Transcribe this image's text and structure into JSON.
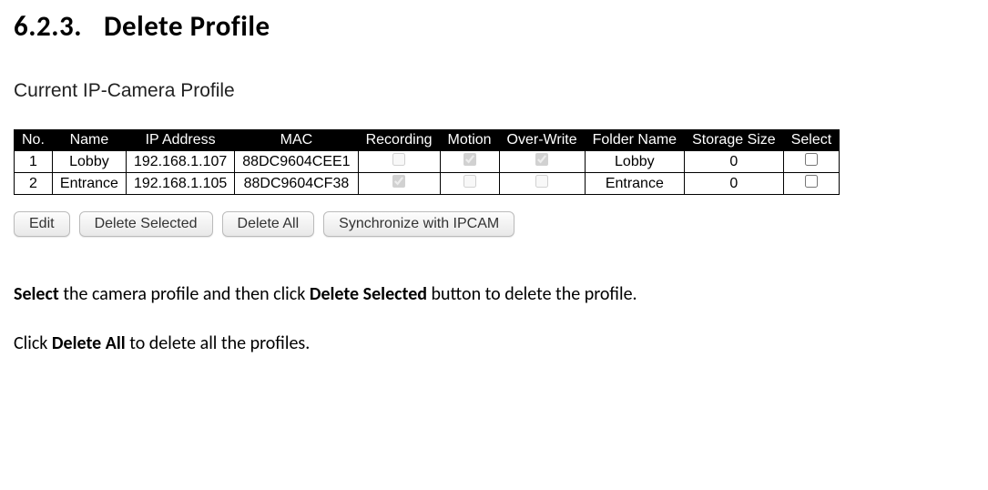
{
  "heading": {
    "number": "6.2.3.",
    "title": "Delete Profile"
  },
  "profileLabel": "Current IP-Camera Profile",
  "table": {
    "headers": {
      "no": "No.",
      "name": "Name",
      "ip": "IP Address",
      "mac": "MAC",
      "recording": "Recording",
      "motion": "Motion",
      "overwrite": "Over-Write",
      "folder": "Folder Name",
      "storage": "Storage Size",
      "select": "Select"
    },
    "rows": [
      {
        "no": "1",
        "name": "Lobby",
        "ip": "192.168.1.107",
        "mac": "88DC9604CEE1",
        "recording": false,
        "motion": true,
        "overwrite": true,
        "folder": "Lobby",
        "storage": "0",
        "select": false
      },
      {
        "no": "2",
        "name": "Entrance",
        "ip": "192.168.1.105",
        "mac": "88DC9604CF38",
        "recording": true,
        "motion": false,
        "overwrite": false,
        "folder": "Entrance",
        "storage": "0",
        "select": false
      }
    ]
  },
  "buttons": {
    "edit": "Edit",
    "deleteSelected": "Delete Selected",
    "deleteAll": "Delete All",
    "sync": "Synchronize with IPCAM"
  },
  "instructions": {
    "line1": {
      "b1": "Select",
      "t1": " the camera profile and then click ",
      "b2": "Delete Selected",
      "t2": " button to delete the profile."
    },
    "line2": {
      "t1": "Click ",
      "b1": "Delete All",
      "t2": " to delete all the profiles."
    }
  }
}
